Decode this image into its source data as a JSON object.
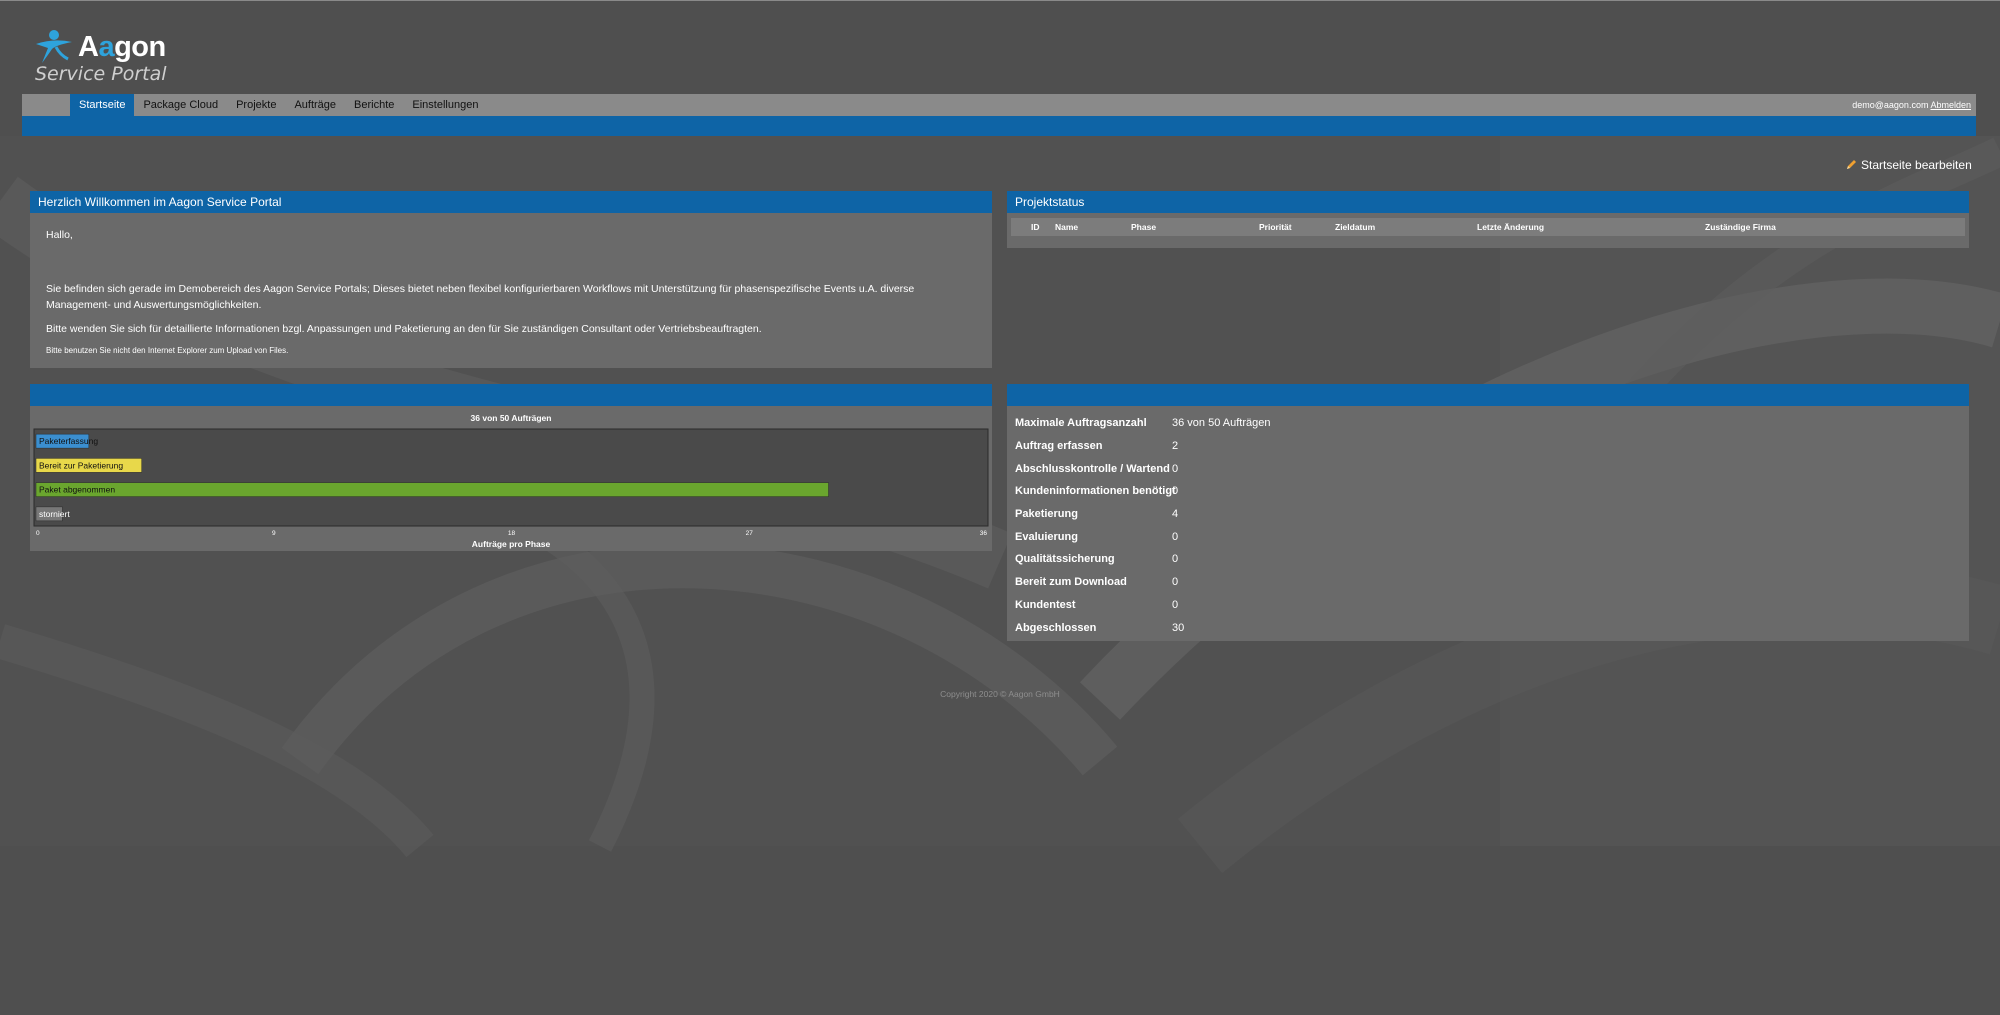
{
  "brand": {
    "name_prefix": "A",
    "name_accent": "a",
    "name_suffix": "gon",
    "subtitle": "Service Portal",
    "accent_color": "#2ea3dc",
    "primary_blue": "#0e64a6"
  },
  "nav": {
    "items": [
      {
        "label": "Startseite",
        "active": true
      },
      {
        "label": "Package Cloud",
        "active": false
      },
      {
        "label": "Projekte",
        "active": false
      },
      {
        "label": "Aufträge",
        "active": false
      },
      {
        "label": "Berichte",
        "active": false
      },
      {
        "label": "Einstellungen",
        "active": false
      }
    ],
    "user_email": "demo@aagon.com",
    "logout_label": "Abmelden"
  },
  "edit_home_label": "Startseite bearbeiten",
  "welcome": {
    "title": "Herzlich Willkommen im Aagon Service Portal",
    "greeting": "Hallo,",
    "paragraph1": "Sie befinden sich gerade im Demobereich des Aagon Service Portals; Dieses bietet neben flexibel konfigurierbaren Workflows mit Unterstützung für phasenspezifische Events u.A. diverse Management- und Auswertungsmöglichkeiten.",
    "paragraph2": "Bitte wenden Sie sich für detaillierte Informationen bzgl. Anpassungen und Paketierung an den für Sie zuständigen Consultant oder Vertriebsbeauftragten.",
    "note": "Bitte benutzen Sie nicht den Internet Explorer zum Upload von Files."
  },
  "projects": {
    "title": "Projektstatus",
    "columns": [
      "ID",
      "Name",
      "Phase",
      "Priorität",
      "Zieldatum",
      "Letzte Änderung",
      "Zuständige Firma"
    ]
  },
  "chart_data": {
    "type": "bar",
    "orientation": "horizontal",
    "title": "36 von 50 Aufträgen",
    "xlabel": "Aufträge pro Phase",
    "categories": [
      "Paketerfassung",
      "Bereit zur Paketierung",
      "Paket abgenommen",
      "storniert"
    ],
    "values": [
      2,
      4,
      30,
      1
    ],
    "colors": [
      "#3b8fd0",
      "#e8d84a",
      "#6aa62e",
      "#777777"
    ],
    "xlim": [
      0,
      36
    ],
    "xticks": [
      "0",
      "9",
      "18",
      "27",
      "36"
    ],
    "grid": false,
    "legend": "none"
  },
  "status": {
    "rows": [
      {
        "label": "Maximale Auftragsanzahl",
        "value": "36 von 50 Aufträgen"
      },
      {
        "label": "Auftrag erfassen",
        "value": "2"
      },
      {
        "label": "Abschlusskontrolle / Wartend",
        "value": "0"
      },
      {
        "label": "Kundeninformationen benötigt",
        "value": "0"
      },
      {
        "label": "Paketierung",
        "value": "4"
      },
      {
        "label": "Evaluierung",
        "value": "0"
      },
      {
        "label": "Qualitätssicherung",
        "value": "0"
      },
      {
        "label": "Bereit zum Download",
        "value": "0"
      },
      {
        "label": "Kundentest",
        "value": "0"
      },
      {
        "label": "Abgeschlossen",
        "value": "30"
      }
    ]
  },
  "footer": {
    "copyright": "Copyright 2020 © Aagon GmbH"
  }
}
